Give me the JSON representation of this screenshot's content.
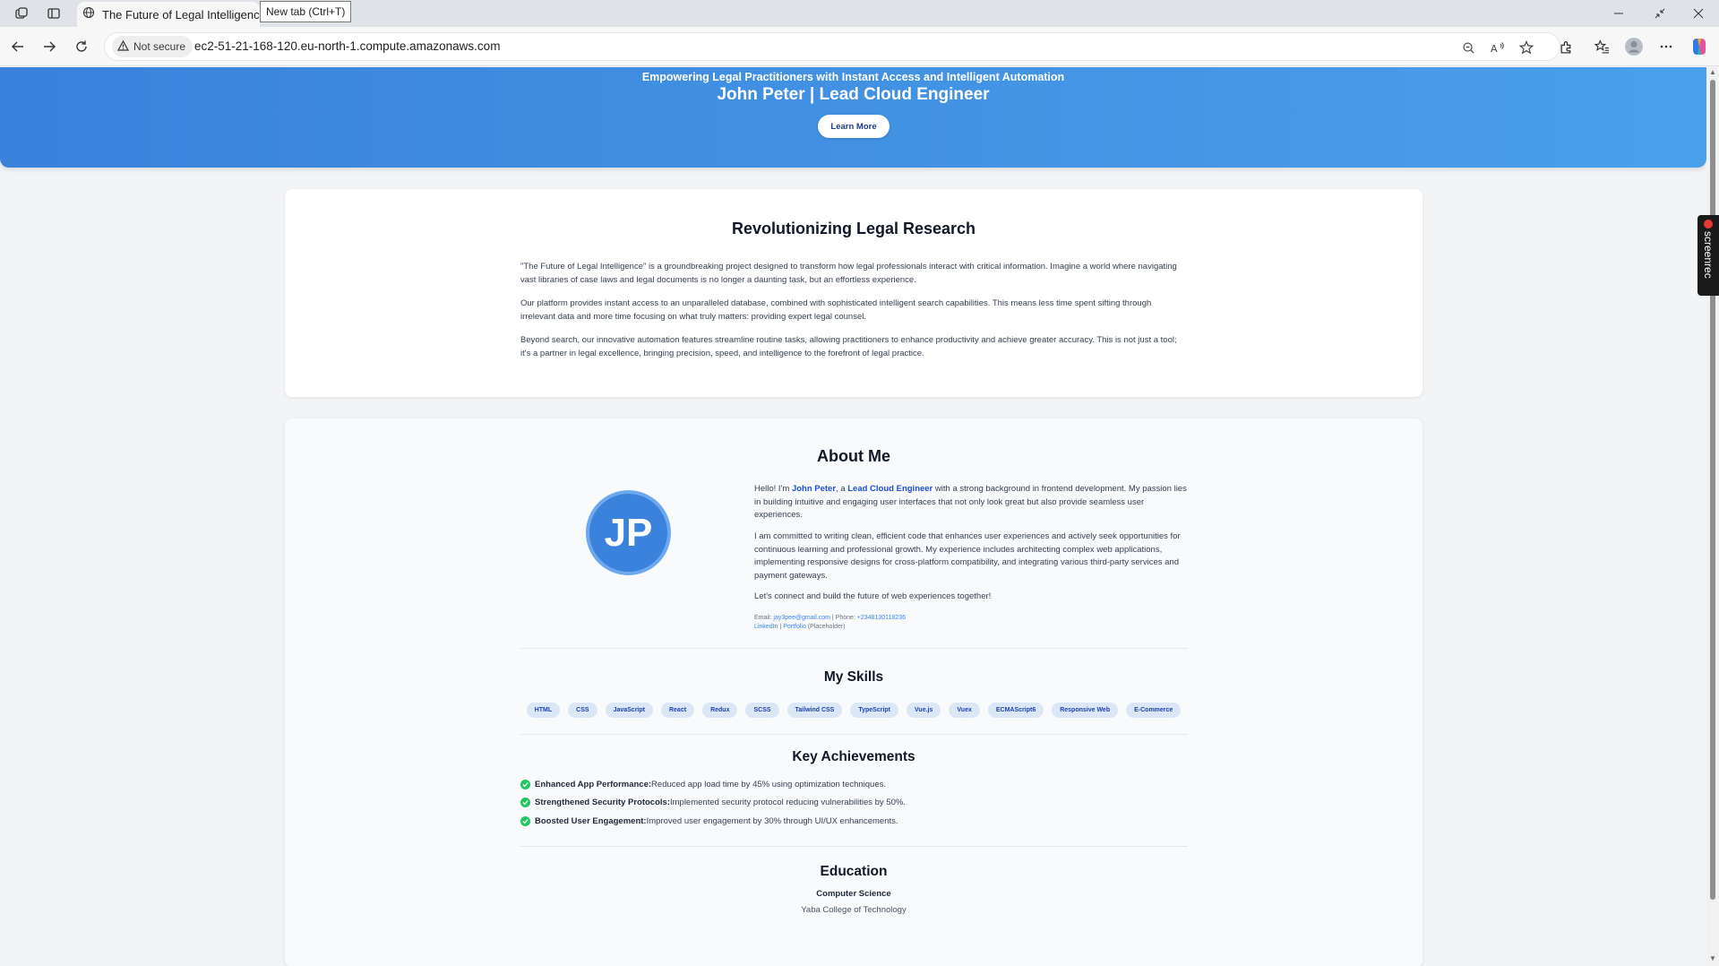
{
  "browser": {
    "tab_title": "The Future of Legal Intelligence",
    "tooltip": "New tab (Ctrl+T)",
    "security_label": "Not secure",
    "url": "ec2-51-21-168-120.eu-north-1.compute.amazonaws.com"
  },
  "hero": {
    "subtitle": "Empowering Legal Practitioners with Instant Access and Intelligent Automation",
    "title": "John Peter | Lead Cloud Engineer",
    "cta_label": "Learn More"
  },
  "intro": {
    "heading": "Revolutionizing Legal Research",
    "paragraphs": [
      "\"The Future of Legal Intelligence\" is a groundbreaking project designed to transform how legal professionals interact with critical information. Imagine a world where navigating vast libraries of case laws and legal documents is no longer a daunting task, but an effortless experience.",
      "Our platform provides instant access to an unparalleled database, combined with sophisticated intelligent search capabilities. This means less time spent sifting through irrelevant data and more time focusing on what truly matters: providing expert legal counsel.",
      "Beyond search, our innovative automation features streamline routine tasks, allowing practitioners to enhance productivity and achieve greater accuracy. This is not just a tool; it's a partner in legal excellence, bringing precision, speed, and intelligence to the forefront of legal practice."
    ]
  },
  "about": {
    "heading": "About Me",
    "initials": "JP",
    "p1_prefix": "Hello! I'm ",
    "name": "John Peter",
    "p1_mid": ", a ",
    "role": "Lead Cloud Engineer",
    "p1_suffix": " with a strong background in frontend development. My passion lies in building intuitive and engaging user interfaces that not only look great but also provide seamless user experiences.",
    "p2": "I am committed to writing clean, efficient code that enhances user experiences and actively seek opportunities for continuous learning and professional growth. My experience includes architecting complex web applications, implementing responsive designs for cross-platform compatibility, and integrating various third-party services and payment gateways.",
    "p3": "Let's connect and build the future of web experiences together!",
    "email_label": "Email: ",
    "email": "jay3pee@gmail.com",
    "phone_label": " | Phone: ",
    "phone": "+2348130118236",
    "linkedin": "LinkedIn",
    "sep": " | ",
    "portfolio": "Portfolio",
    "placeholder_note": " (Placeholder)"
  },
  "skills": {
    "heading": "My Skills",
    "items": [
      "HTML",
      "CSS",
      "JavaScript",
      "React",
      "Redux",
      "SCSS",
      "Tailwind CSS",
      "TypeScript",
      "Vue.js",
      "Vuex",
      "ECMAScript6",
      "Responsive Web",
      "E-Commerce"
    ]
  },
  "achievements": {
    "heading": "Key Achievements",
    "items": [
      {
        "title": "Enhanced App Performance:",
        "text": "Reduced app load time by 45% using optimization techniques."
      },
      {
        "title": "Strengthened Security Protocols:",
        "text": "Implemented security protocol reducing vulnerabilities by 50%."
      },
      {
        "title": "Boosted User Engagement:",
        "text": "Improved user engagement by 30% through UI/UX enhancements."
      }
    ]
  },
  "education": {
    "heading": "Education",
    "degree": "Computer Science",
    "school": "Yaba College of Technology"
  },
  "overlay": {
    "label": "screenrec"
  },
  "colors": {
    "hero_gradient_start": "#3a82dc",
    "hero_gradient_end": "#4aa0ea",
    "accent": "#1d4ed8",
    "success": "#22c55e"
  }
}
